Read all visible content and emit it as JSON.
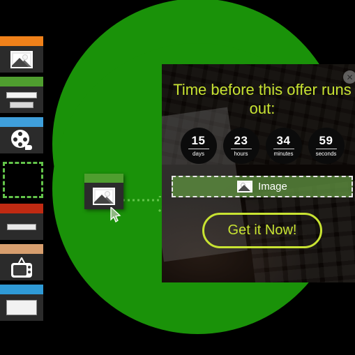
{
  "canvas": {
    "background_color": "#000000",
    "circle_color": "#1a9209"
  },
  "sidebar": {
    "name": "widget-palette",
    "items": [
      {
        "id": "image-widget",
        "icon": "photo-icon",
        "header_color": "#f0811a",
        "content": "image"
      },
      {
        "id": "text-widget",
        "icon": "lines-icon",
        "header_color": "#4f9e2f",
        "content": "lines"
      },
      {
        "id": "video-widget",
        "icon": "film-reel-icon",
        "header_color": "#3f9fdb",
        "content": "film"
      },
      {
        "id": "empty-slot",
        "icon": "dashed-placeholder",
        "header_color": "transparent",
        "content": "empty"
      },
      {
        "id": "button-widget",
        "icon": "single-line-icon",
        "header_color": "#c02a12",
        "content": "line"
      },
      {
        "id": "tv-widget",
        "icon": "tv-icon",
        "header_color": "#d79e6e",
        "content": "tv"
      },
      {
        "id": "form-widget",
        "icon": "box-icon",
        "header_color": "#2f9ad6",
        "content": "box"
      }
    ]
  },
  "drag": {
    "card_name": "dragged-image-widget",
    "card_header_color": "#4f9e2f",
    "icon": "photo-icon",
    "cursor": "arrow-cursor",
    "trail": "dotted-drag-trail"
  },
  "popup": {
    "name": "countdown-offer-popup",
    "close_label": "✕",
    "headline": "Time before this offer runs out:",
    "headline_color": "#c8e332",
    "timer": [
      {
        "value": "15",
        "label": "days"
      },
      {
        "value": "23",
        "label": "hours"
      },
      {
        "value": "34",
        "label": "minutes"
      },
      {
        "value": "59",
        "label": "seconds"
      }
    ],
    "dropzone": {
      "label": "Image",
      "icon": "image-icon",
      "fill_color": "#5c8d3e"
    },
    "cta": {
      "label": "Get it Now!",
      "color": "#c8e332"
    }
  }
}
